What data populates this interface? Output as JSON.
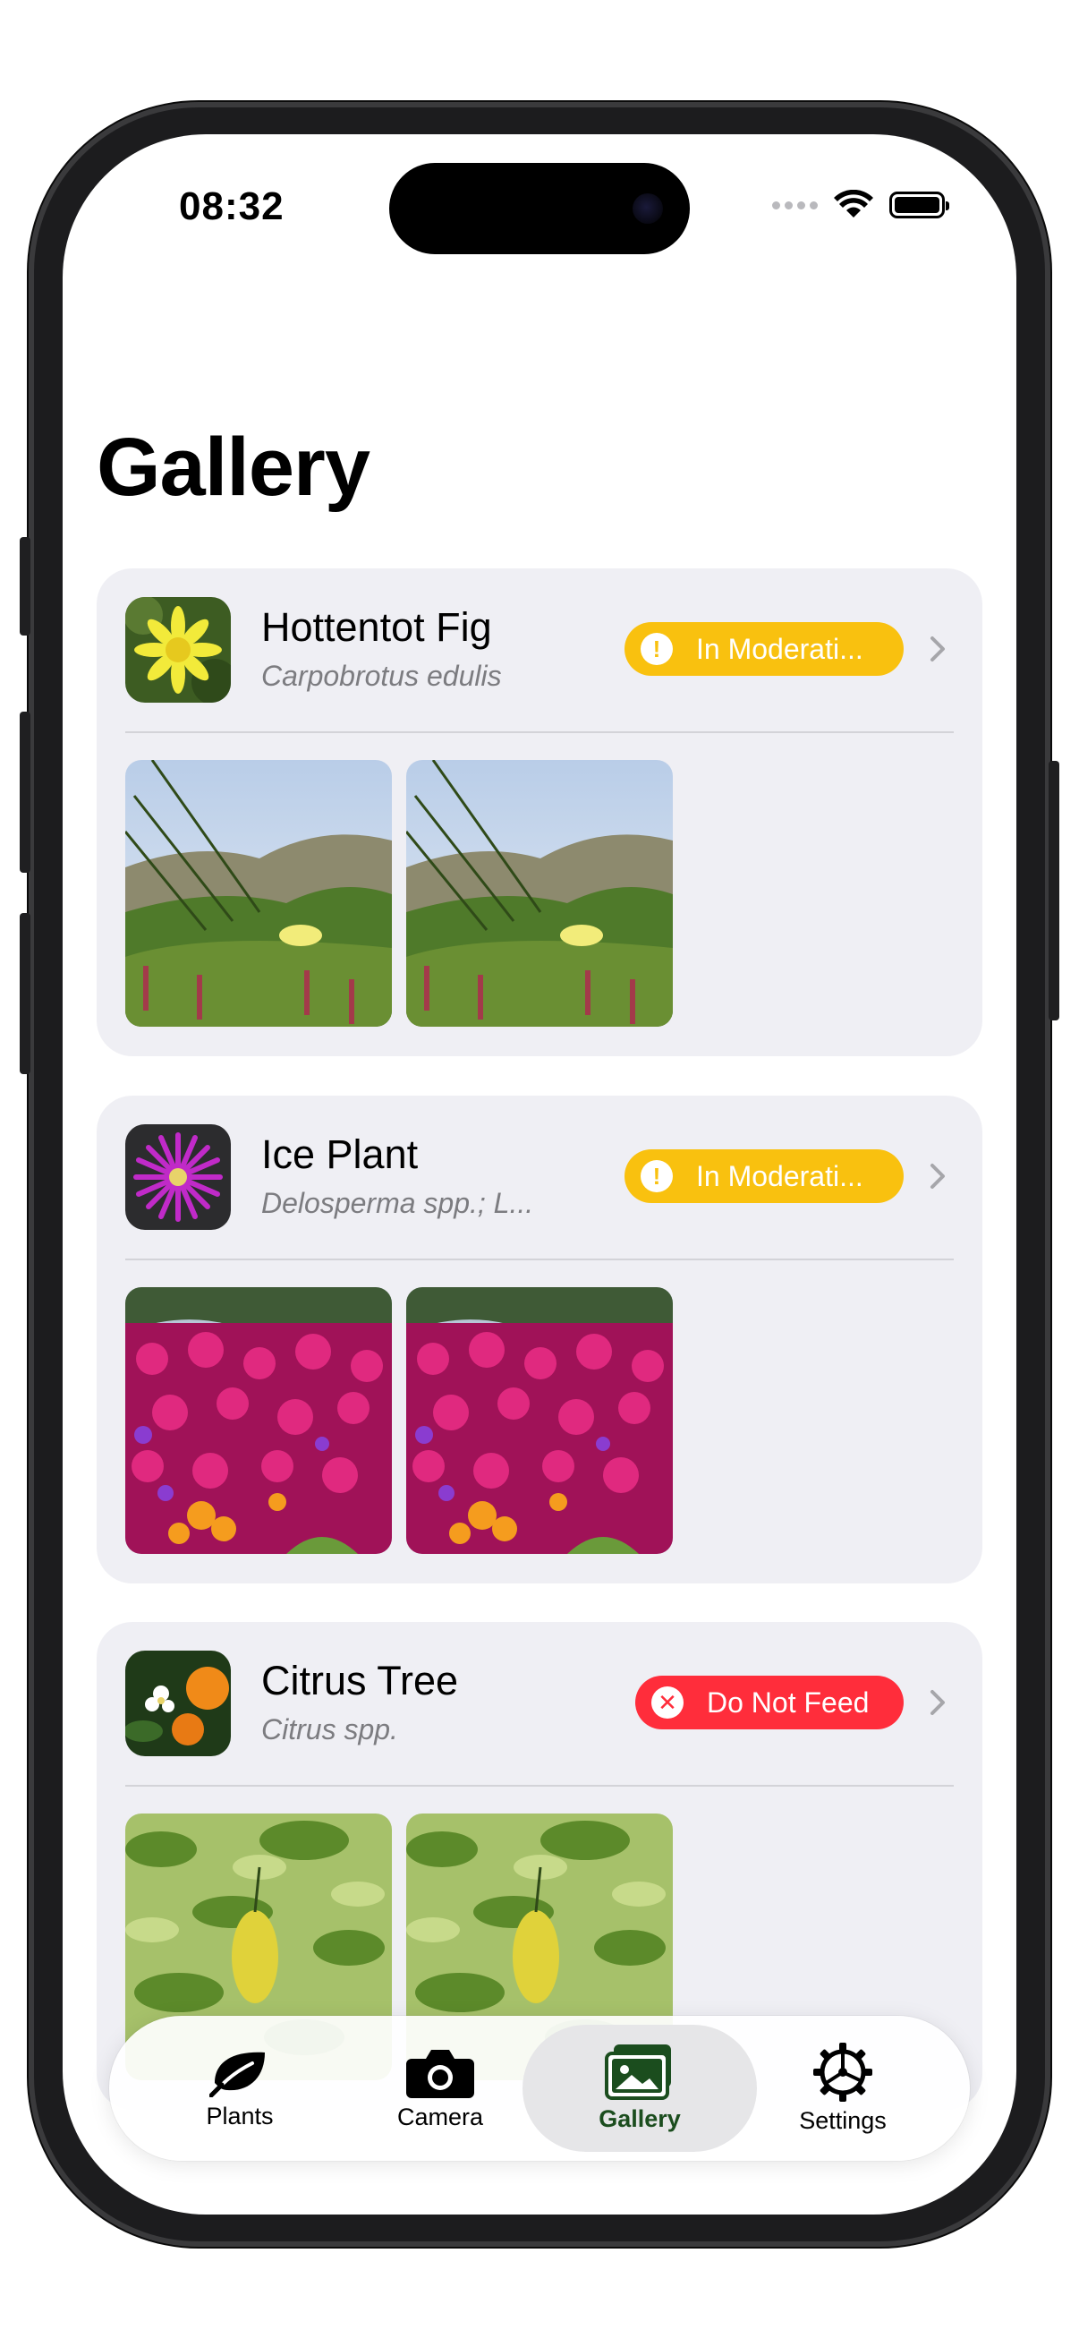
{
  "status_bar": {
    "time": "08:32"
  },
  "page": {
    "title": "Gallery"
  },
  "cards": [
    {
      "name": "Hottentot Fig",
      "scientific": "Carpobrotus edulis",
      "status": "In Moderati...",
      "status_kind": "warning",
      "status_color": "#f9c10f",
      "photo_count": 2
    },
    {
      "name": "Ice Plant",
      "scientific": "Delosperma spp.; L...",
      "status": "In Moderati...",
      "status_kind": "warning",
      "status_color": "#f9c10f",
      "photo_count": 2
    },
    {
      "name": "Citrus Tree",
      "scientific": "Citrus spp.",
      "status": "Do Not Feed",
      "status_kind": "danger",
      "status_color": "#ff2d3b",
      "photo_count": 2
    }
  ],
  "tabbar": {
    "items": [
      {
        "label": "Plants",
        "icon": "leaf-icon"
      },
      {
        "label": "Camera",
        "icon": "camera-icon"
      },
      {
        "label": "Gallery",
        "icon": "photos-icon",
        "active": true
      },
      {
        "label": "Settings",
        "icon": "gear-icon"
      }
    ],
    "active_color": "#1b4d1e"
  }
}
